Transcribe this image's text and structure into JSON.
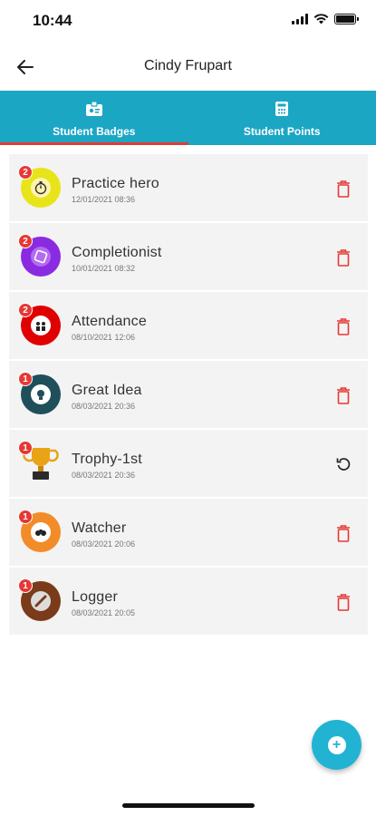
{
  "status_bar": {
    "time": "10:44"
  },
  "header": {
    "title": "Cindy Frupart"
  },
  "tabs": [
    {
      "label": "Student Badges",
      "icon": "badge-icon",
      "active": true
    },
    {
      "label": "Student Points",
      "icon": "points-icon",
      "active": false
    }
  ],
  "badges": [
    {
      "name": "Practice hero",
      "date": "12/01/2021 08:36",
      "count": "2",
      "color": "#e8e41a",
      "inner": "#f5c400",
      "icon": "stopwatch-icon",
      "action": "delete-icon"
    },
    {
      "name": "Completionist",
      "date": "10/01/2021 08:32",
      "count": "2",
      "color": "#8a2be2",
      "inner": "#b36bf0",
      "icon": "check-square-icon",
      "action": "delete-icon"
    },
    {
      "name": "Attendance",
      "date": "08/10/2021 12:06",
      "count": "2",
      "color": "#e00000",
      "inner": "#ffffff",
      "icon": "people-icon",
      "action": "delete-icon"
    },
    {
      "name": "Great Idea",
      "date": "08/03/2021 20:36",
      "count": "1",
      "color": "#1f4f5a",
      "inner": "#ffffff",
      "icon": "lightbulb-icon",
      "action": "delete-icon"
    },
    {
      "name": "Trophy-1st",
      "date": "08/03/2021 20:36",
      "count": "1",
      "color": "#ffffff",
      "inner": "#e8a317",
      "icon": "trophy-icon",
      "action": "restore-icon"
    },
    {
      "name": "Watcher",
      "date": "08/03/2021 20:06",
      "count": "1",
      "color": "#f28c28",
      "inner": "#ffffff",
      "icon": "binoculars-icon",
      "action": "delete-icon"
    },
    {
      "name": "Logger",
      "date": "08/03/2021 20:05",
      "count": "1",
      "color": "#7a3b1a",
      "inner": "#dcdcdc",
      "icon": "log-icon",
      "action": "delete-icon"
    }
  ],
  "colors": {
    "accent": "#1ba6c4",
    "danger": "#e53935",
    "fab": "#22b3d3"
  }
}
